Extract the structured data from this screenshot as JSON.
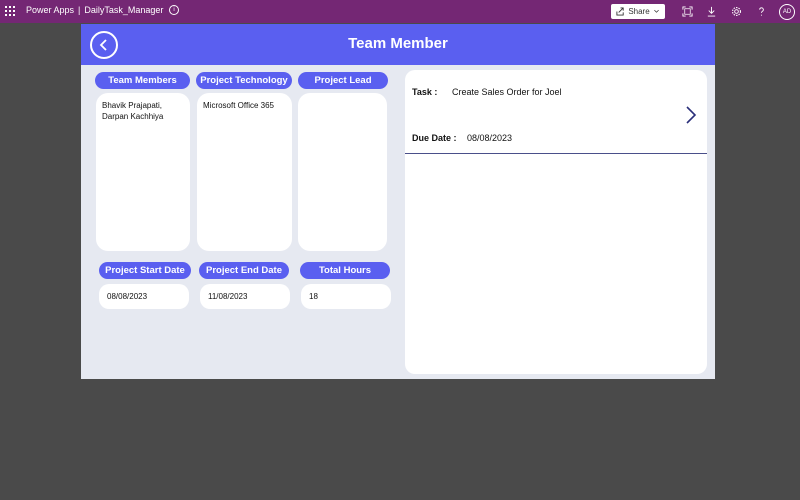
{
  "topbar": {
    "app_name": "Power Apps",
    "separator": "|",
    "app_file": "DailyTask_Manager",
    "share_label": "Share",
    "avatar_initials": "AD"
  },
  "header": {
    "title": "Team Member"
  },
  "sections": {
    "team_members": {
      "label": "Team Members",
      "value": "Bhavik Prajapati, Darpan Kachhiya"
    },
    "project_technology": {
      "label": "Project Technology",
      "value": "Microsoft Office 365"
    },
    "project_lead": {
      "label": "Project Lead",
      "value": ""
    },
    "project_start_date": {
      "label": "Project Start Date",
      "value": "08/08/2023"
    },
    "project_end_date": {
      "label": "Project End Date",
      "value": "11/08/2023"
    },
    "total_hours": {
      "label": "Total Hours",
      "value": "18"
    }
  },
  "task_card": {
    "task_label": "Task :",
    "task_value": "Create Sales Order for Joel",
    "due_label": "Due Date :",
    "due_value": "08/08/2023"
  },
  "colors": {
    "topbar": "#742774",
    "accent": "#5a5ff0",
    "canvas_bg": "#e6e9f1",
    "outer_bg": "#4a4a4a"
  }
}
